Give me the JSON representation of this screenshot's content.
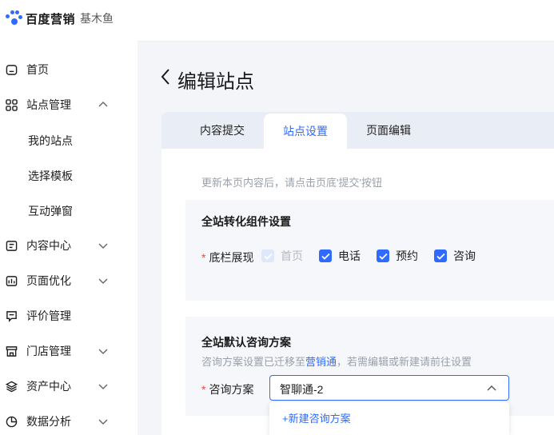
{
  "brand": {
    "name": "百度营销",
    "product": "基木鱼",
    "accent": "#2f6bff"
  },
  "sidebar": {
    "items": [
      {
        "label": "首页",
        "icon": "home-icon"
      },
      {
        "label": "站点管理",
        "icon": "grid-icon",
        "expanded": true,
        "children": [
          {
            "label": "我的站点"
          },
          {
            "label": "选择模板"
          },
          {
            "label": "互动弹窗"
          }
        ]
      },
      {
        "label": "内容中心",
        "icon": "content-icon"
      },
      {
        "label": "页面优化",
        "icon": "optimize-icon"
      },
      {
        "label": "评价管理",
        "icon": "comment-icon"
      },
      {
        "label": "门店管理",
        "icon": "store-icon"
      },
      {
        "label": "资产中心",
        "icon": "layers-icon"
      },
      {
        "label": "数据分析",
        "icon": "pie-chart-icon"
      }
    ]
  },
  "page": {
    "title": "编辑站点"
  },
  "tabs": [
    {
      "label": "内容提交",
      "active": false
    },
    {
      "label": "站点设置",
      "active": true
    },
    {
      "label": "页面编辑",
      "active": false
    }
  ],
  "hint": "更新本页内容后，请点击页底'提交'按钮",
  "conversion": {
    "title": "全站转化组件设置",
    "field_label": "底栏展现",
    "options": [
      {
        "label": "首页",
        "checked": true,
        "disabled": true
      },
      {
        "label": "电话",
        "checked": true,
        "disabled": false
      },
      {
        "label": "预约",
        "checked": true,
        "disabled": false
      },
      {
        "label": "咨询",
        "checked": true,
        "disabled": false
      }
    ]
  },
  "consult": {
    "title": "全站默认咨询方案",
    "desc_before": "咨询方案设置已迁移至",
    "desc_link": "营销通",
    "desc_after": "，若需编辑或新建请前往设置",
    "field_label": "咨询方案",
    "selected": "智聊通-2",
    "dropdown_option": "+新建咨询方案"
  }
}
